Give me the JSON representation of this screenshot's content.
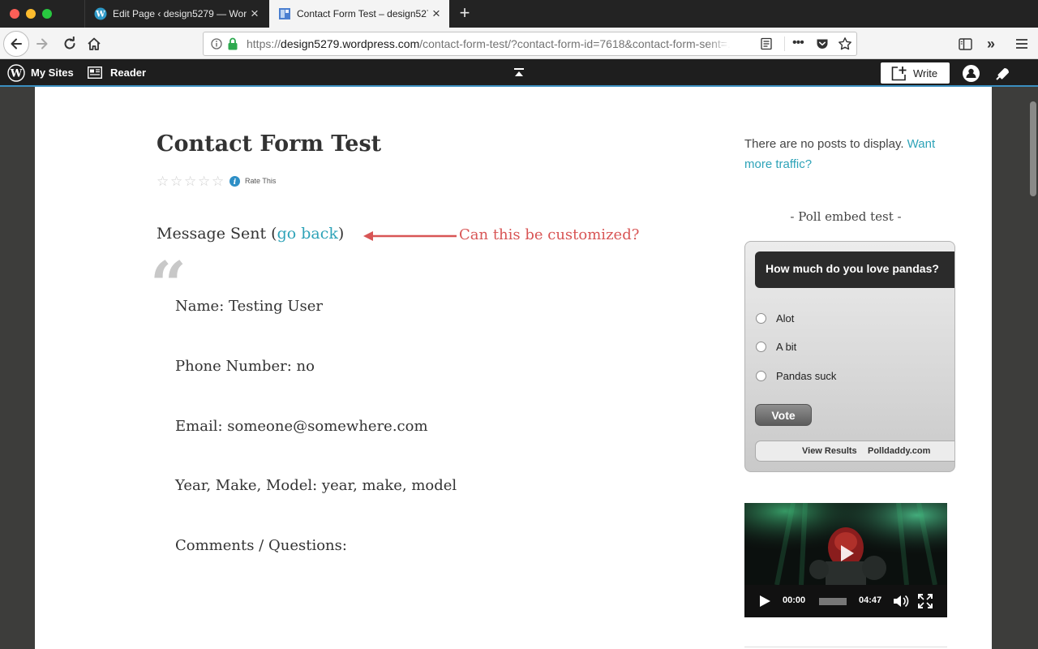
{
  "browser": {
    "tabs": [
      {
        "title": "Edit Page ‹ design5279 — WordPress.com",
        "active": false
      },
      {
        "title": "Contact Form Test – design5279",
        "active": true
      }
    ],
    "url_scheme": "https://",
    "url_domain": "design5279.wordpress.com",
    "url_path": "/contact-form-test/?contact-form-id=7618&contact-form-sent=..."
  },
  "wpbar": {
    "my_sites": "My Sites",
    "reader": "Reader",
    "write": "Write"
  },
  "post": {
    "title": "Contact Form Test",
    "rate_label": "Rate This",
    "stars_filled": 0,
    "stars_total": 5,
    "message_prefix": "Message Sent (",
    "message_link": "go back",
    "message_suffix": ")",
    "annotation": "Can this be customized?",
    "fields": [
      "Name: Testing User",
      "Phone Number: no",
      "Email: someone@somewhere.com",
      "Year, Make, Model: year, make, model",
      "Comments / Questions:"
    ]
  },
  "sidebar": {
    "no_posts_text": "There are no posts to display.",
    "no_posts_link": "Want more traffic?",
    "poll_widget_title": "- Poll embed test -",
    "poll": {
      "question": "How much do you love pandas?",
      "options": [
        "Alot",
        "A bit",
        "Pandas suck"
      ],
      "vote": "Vote",
      "view_results": "View Results",
      "brand": "Polldaddy.com"
    },
    "video": {
      "current_time": "00:00",
      "duration": "04:47"
    }
  },
  "colors": {
    "link": "#2ea3b8",
    "annotation": "#d85555",
    "admin_bar": "#1e1e1e"
  }
}
